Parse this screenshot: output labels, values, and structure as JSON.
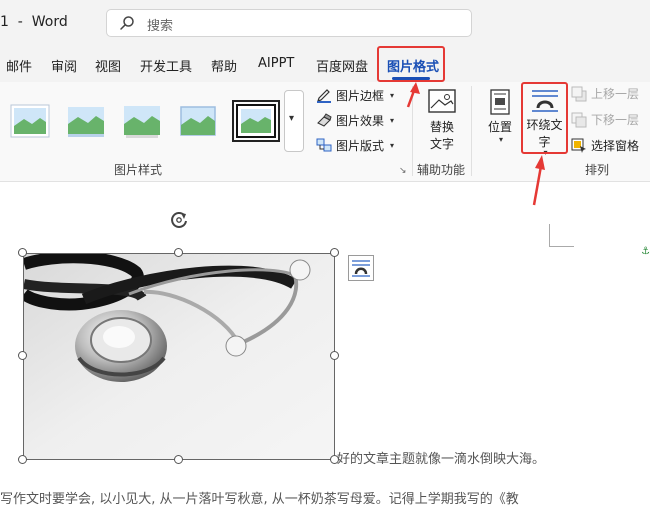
{
  "titlebar": {
    "title": "1  -  Word",
    "search_placeholder": "搜索"
  },
  "tabs": [
    "邮件",
    "审阅",
    "视图",
    "开发工具",
    "帮助",
    "AIPPT",
    "百度网盘",
    "图片格式"
  ],
  "ribbon": {
    "picture_styles": {
      "group_label": "图片样式",
      "menu": [
        "图片边框",
        "图片效果",
        "图片版式"
      ]
    },
    "accessibility": {
      "alt_text_line1": "替换",
      "alt_text_line2": "文字",
      "group_label": "辅助功能"
    },
    "arrange": {
      "position_label": "位置",
      "wrap_line1": "环绕文",
      "wrap_line2": "字",
      "bring_forward": "上移一层",
      "send_backward": "下移一层",
      "selection_pane": "选择窗格",
      "group_label": "排列"
    }
  },
  "document": {
    "line1": "好的文章主题就像一滴水倒映大海。",
    "line2": "写作文时要学会, 以小见大, 从一片落叶写秋意, 从一杯奶茶写母爱。记得上学期我写的《教"
  },
  "colors": {
    "accent_blue": "#1a4fb5",
    "highlight_red": "#e53935"
  }
}
